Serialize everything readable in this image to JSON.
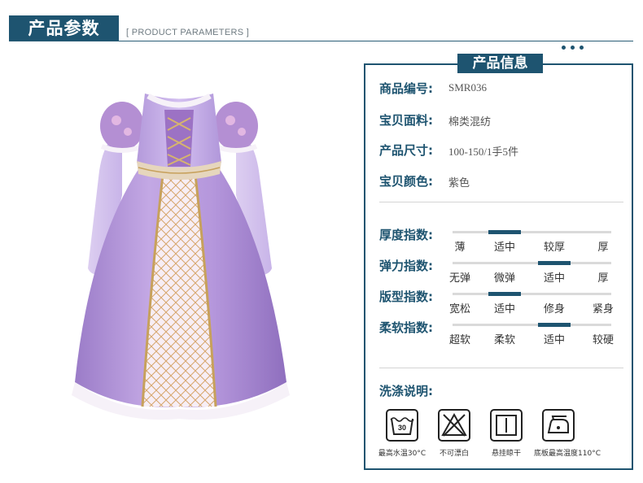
{
  "header": {
    "title": "产品参数",
    "subtitle": "[ PRODUCT PARAMETERS ]"
  },
  "product_image": {
    "alt": "purple princess dress",
    "colors": {
      "satin": "#b79ad6",
      "satin_dark": "#8d6cbc",
      "bodice": "#c9b2e6",
      "lace": "#f6f1f8",
      "gold": "#c7a15c"
    }
  },
  "info_panel": {
    "tab_title": "产品信息",
    "rows": [
      {
        "label": "商品编号:",
        "value": "SMR036"
      },
      {
        "label": "宝贝面料:",
        "value": "棉类混纺"
      },
      {
        "label": "产品尺寸:",
        "value": "100-150/1手5件"
      },
      {
        "label": "宝贝颜色:",
        "value": "紫色"
      }
    ]
  },
  "scales": [
    {
      "label": "厚度指数:",
      "options": [
        "薄",
        "适中",
        "较厚",
        "厚"
      ],
      "selected": 1
    },
    {
      "label": "弹力指数:",
      "options": [
        "无弹",
        "微弹",
        "适中",
        "厚"
      ],
      "selected": 2
    },
    {
      "label": "版型指数:",
      "options": [
        "宽松",
        "适中",
        "修身",
        "紧身"
      ],
      "selected": 1
    },
    {
      "label": "柔软指数:",
      "options": [
        "超软",
        "柔软",
        "适中",
        "较硬"
      ],
      "selected": 2
    }
  ],
  "care": {
    "label": "洗涤说明:",
    "items": [
      {
        "icon": "wash-30-icon",
        "text": "最高水温30°C",
        "temp": "30"
      },
      {
        "icon": "no-bleach-icon",
        "text": "不可漂白"
      },
      {
        "icon": "hang-dry-icon",
        "text": "悬挂晾干"
      },
      {
        "icon": "iron-icon",
        "text": "底板最高温度110°C"
      }
    ]
  },
  "accent_color": "#1e5470"
}
